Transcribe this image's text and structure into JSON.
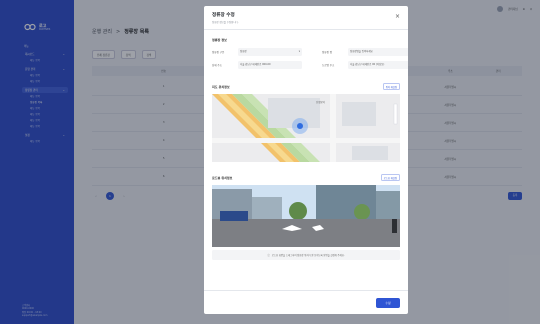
{
  "app": {
    "logo_name": "로고",
    "logo_sub": "PARTNER",
    "brand_color": "#2b4bcb",
    "accent_color": "#2f55d4"
  },
  "sidebar": {
    "section_label": "메뉴",
    "items": [
      {
        "label": "대시보드",
        "subs": [
          "메뉴 항목"
        ]
      },
      {
        "label": "운영 관리",
        "subs": [
          "메뉴 항목",
          "메뉴 항목"
        ]
      },
      {
        "label": "정류장 관리",
        "subs": [
          "메뉴 항목",
          "정류장 목록",
          "메뉴 항목",
          "메뉴 항목",
          "메뉴 항목",
          "메뉴 항목"
        ]
      },
      {
        "label": "설정",
        "subs": [
          "메뉴 항목"
        ]
      }
    ],
    "footer_lines": [
      "고객센터",
      "0000-0000",
      "평일 09:00 - 18:00",
      "support@example.com"
    ]
  },
  "topbar": {
    "user": "관리자님",
    "user_sub": "partner"
  },
  "page": {
    "breadcrumb_parent": "운행 관리",
    "breadcrumb_sep": ">",
    "breadcrumb_current": "정류장 목록",
    "filters": [
      "전체 정류장",
      "검색",
      "검색"
    ],
    "table_headers": [
      "",
      "번호",
      "정류장명",
      "",
      "",
      "",
      "",
      "주소",
      "관리"
    ],
    "rows": [
      [
        "",
        "1",
        "정류장",
        "",
        "",
        "",
        "",
        "서울특별시",
        ""
      ],
      [
        "",
        "2",
        "정류장",
        "",
        "",
        "",
        "",
        "서울특별시",
        ""
      ],
      [
        "",
        "3",
        "정류장",
        "",
        "",
        "",
        "",
        "서울특별시",
        ""
      ],
      [
        "",
        "4",
        "정류장",
        "",
        "",
        "",
        "",
        "서울특별시",
        ""
      ],
      [
        "",
        "5",
        "정류장",
        "",
        "",
        "",
        "",
        "서울특별시",
        ""
      ],
      [
        "",
        "6",
        "정류장",
        "",
        "",
        "",
        "",
        "서울특별시",
        ""
      ]
    ],
    "pager": [
      "‹",
      "1",
      "›"
    ],
    "register_label": "등록"
  },
  "modal": {
    "title": "정류장 수정",
    "subtitle": "정류장 정보를 수정합니다.",
    "close_icon": "×",
    "basic_section": "정류장 정보",
    "fields": {
      "name_label": "정류장 구분",
      "name_value": "정류장",
      "type_label": "정류장 명",
      "type_value": "정류장명을 입력하세요",
      "addr_label": "상세 주소",
      "addr_value": "서울 강남구 테헤란로 000-00",
      "addr2_label": "도로명 주소",
      "addr2_value": "서울 강남구 테헤란로 00 (역삼동)"
    },
    "map_section": "지도 위치정보",
    "map_button": "위치 재설정",
    "map_label": "선정릉역",
    "sv_section": "로드뷰 위치정보",
    "sv_button": "로드뷰 재설정",
    "notice": "로드뷰 화면을 드래그하여 정류장 위치가 잘 보이도록 방향을 설정해 주세요.",
    "confirm_label": "수정"
  }
}
